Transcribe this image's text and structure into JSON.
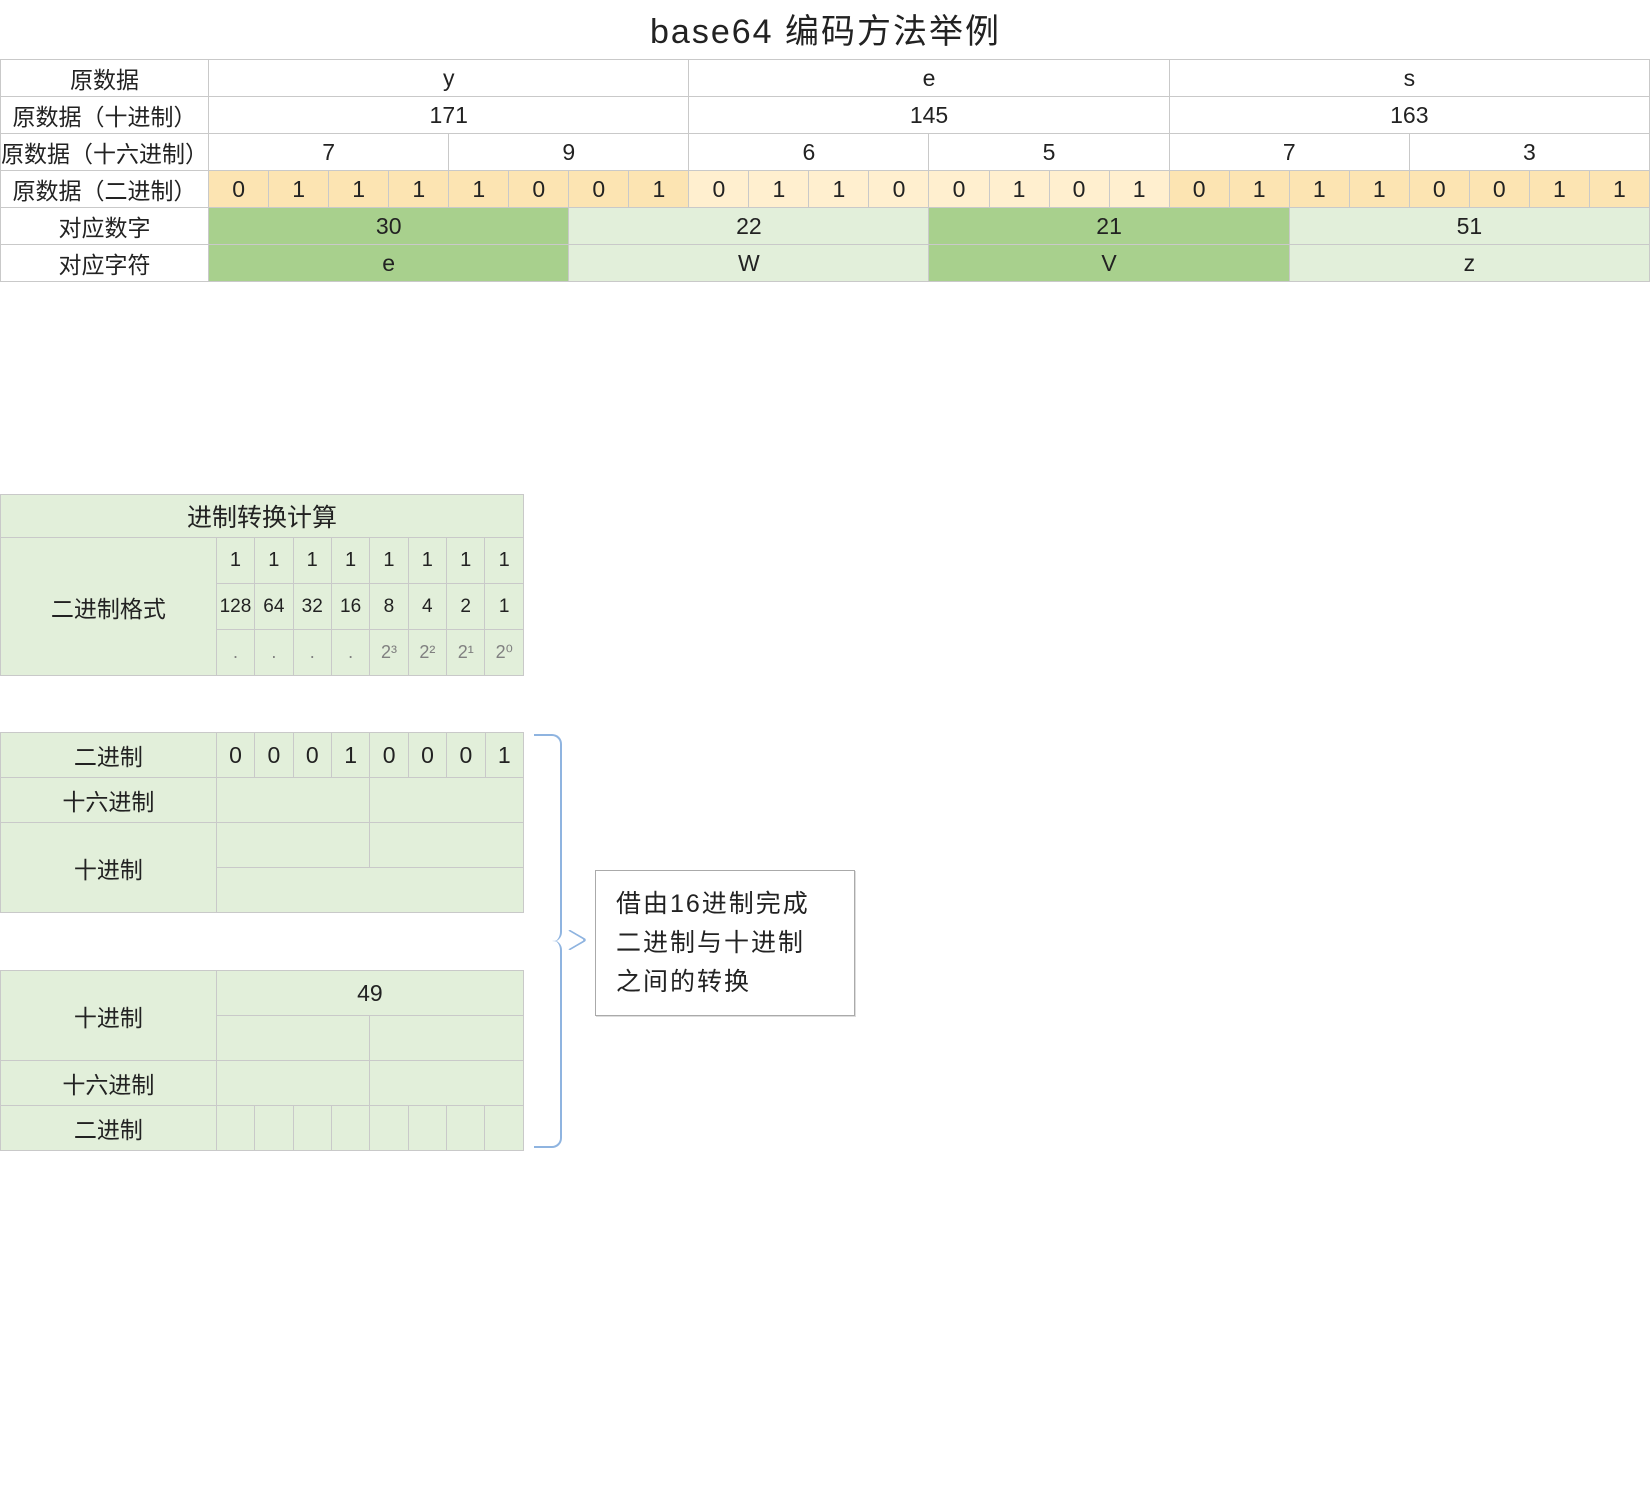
{
  "title": "base64 编码方法举例",
  "row_labels": {
    "raw": "原数据",
    "dec": "原数据（十进制）",
    "hex": "原数据（十六进制）",
    "bin": "原数据（二进制）",
    "numIdx": "对应数字",
    "char": "对应字符"
  },
  "raw_chars": [
    "y",
    "e",
    "s"
  ],
  "dec_vals": [
    "171",
    "145",
    "163"
  ],
  "hex_nibbles": [
    "7",
    "9",
    "6",
    "5",
    "7",
    "3"
  ],
  "bits": [
    "0",
    "1",
    "1",
    "1",
    "1",
    "0",
    "0",
    "1",
    "0",
    "1",
    "1",
    "0",
    "0",
    "1",
    "0",
    "1",
    "0",
    "1",
    "1",
    "1",
    "0",
    "0",
    "1",
    "1"
  ],
  "num_idx": [
    "30",
    "22",
    "21",
    "51"
  ],
  "b64_chars": [
    "e",
    "W",
    "V",
    "z"
  ],
  "conv": {
    "header": "进制转换计算",
    "binfmt_label": "二进制格式",
    "ones_row": [
      "1",
      "1",
      "1",
      "1",
      "1",
      "1",
      "1",
      "1"
    ],
    "weights_row": [
      "128",
      "64",
      "32",
      "16",
      "8",
      "4",
      "2",
      "1"
    ],
    "powers_row": [
      ".",
      ".",
      ".",
      ".",
      "2³",
      "2²",
      "2¹",
      "2⁰"
    ],
    "bin_label": "二进制",
    "hex_label": "十六进制",
    "dec_label": "十进制",
    "example_bits": [
      "0",
      "0",
      "0",
      "1",
      "0",
      "0",
      "0",
      "1"
    ],
    "dec_value": "49"
  },
  "note": {
    "l1": "借由16进制完成",
    "l2": "二进制与十进制",
    "l3": "之间的转换"
  }
}
